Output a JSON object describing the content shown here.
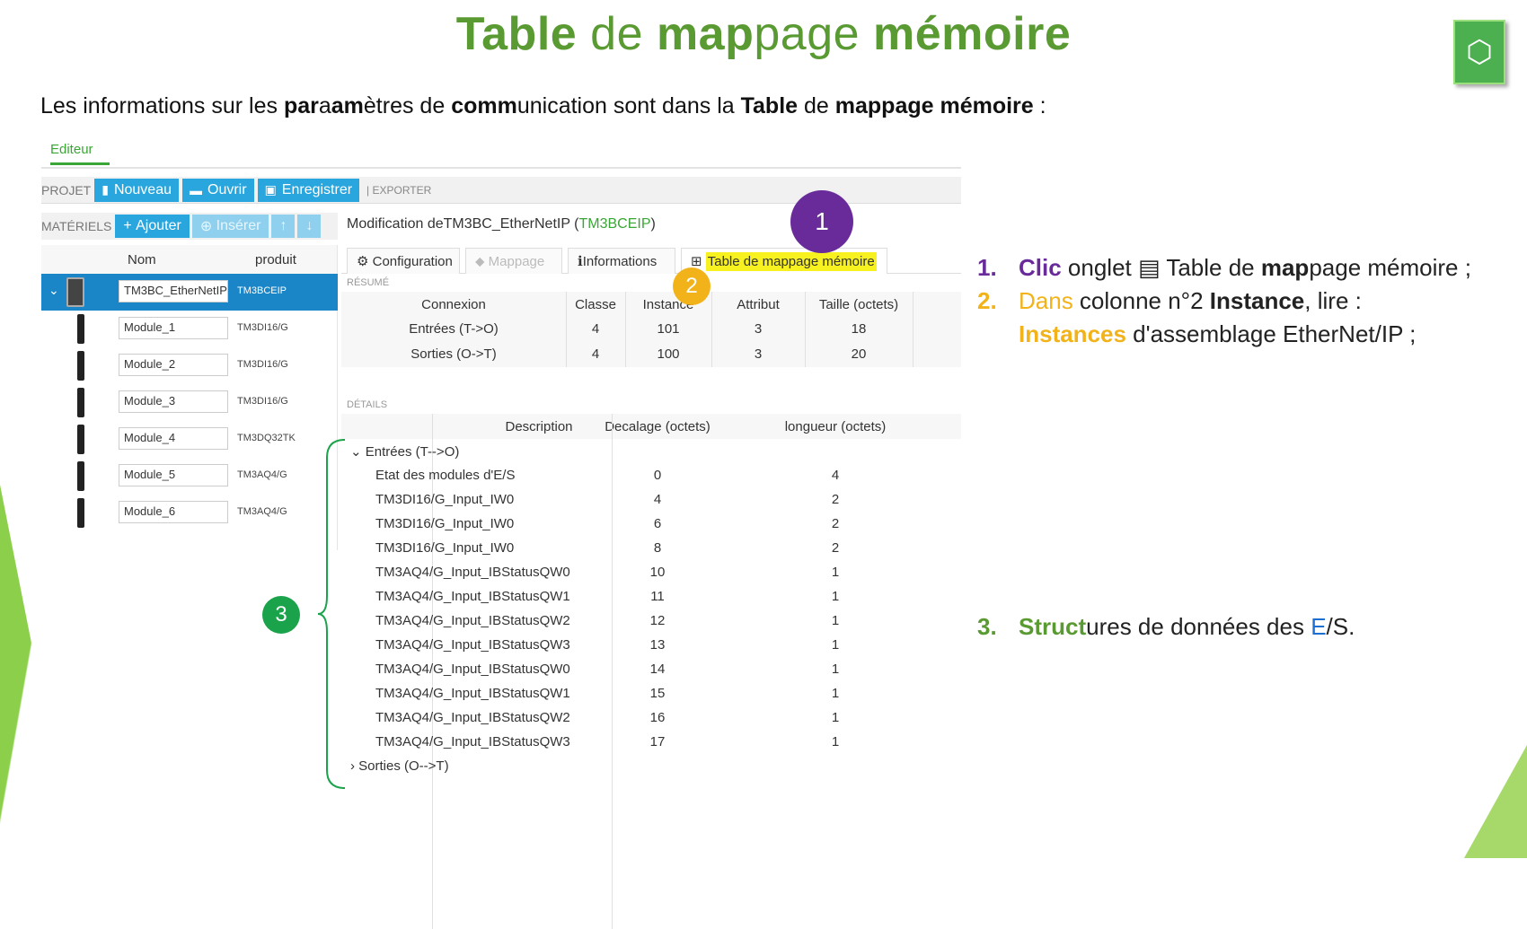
{
  "title": {
    "p1": "Table",
    "p2": " de ",
    "p3": "map",
    "p4": "page ",
    "p5": "mémoire"
  },
  "subtitle": {
    "a": "Les informations sur les ",
    "b": "par",
    "c": "a",
    "d": "am",
    "e": "ètres de ",
    "f": "comm",
    "g": "unication sont dans la ",
    "h": "Table",
    "i": " de ",
    "j": "mappage mémoire",
    "k": " :"
  },
  "editor": {
    "tab_label": "Editeur",
    "toolbar": {
      "projet": "PROJET",
      "nouveau": "Nouveau",
      "ouvrir": "Ouvrir",
      "enregistrer": "Enregistrer",
      "exporter": "| EXPORTER"
    },
    "materiels": {
      "label": "MATÉRIELS",
      "ajouter": "Ajouter",
      "inserer": "Insérer"
    },
    "modification": {
      "prefix": "Modification deTM3BC_EtherNetIP (",
      "ref": "TM3BCEIP",
      "suffix": ")"
    },
    "tree": {
      "col_nom": "Nom",
      "col_produit": "produit",
      "rows": [
        {
          "name": "TM3BC_EtherNetIP",
          "product": "TM3BCEIP"
        },
        {
          "name": "Module_1",
          "product": "TM3DI16/G"
        },
        {
          "name": "Module_2",
          "product": "TM3DI16/G"
        },
        {
          "name": "Module_3",
          "product": "TM3DI16/G"
        },
        {
          "name": "Module_4",
          "product": "TM3DQ32TK"
        },
        {
          "name": "Module_5",
          "product": "TM3AQ4/G"
        },
        {
          "name": "Module_6",
          "product": "TM3AQ4/G"
        }
      ]
    },
    "tabs": {
      "configuration": "Configuration",
      "mappage": "Mappage",
      "informations": "Informations",
      "table": "Table de mappage mémoire"
    },
    "resume": {
      "label": "RÉSUMÉ",
      "headers": [
        "Connexion",
        "Classe",
        "Instance",
        "Attribut",
        "Taille (octets)"
      ],
      "rows": [
        [
          "Entrées (T->O)",
          "4",
          "101",
          "3",
          "18"
        ],
        [
          "Sorties (O->T)",
          "4",
          "100",
          "3",
          "20"
        ]
      ]
    },
    "details": {
      "label": "DÉTAILS",
      "headers": [
        "Description",
        "Decalage (octets)",
        "longueur (octets)"
      ],
      "group_in": "Entrées (T-->O)",
      "group_out": "Sorties (O-->T)",
      "rows": [
        [
          "Etat des modules d'E/S",
          "0",
          "4"
        ],
        [
          "TM3DI16/G_Input_IW0",
          "4",
          "2"
        ],
        [
          "TM3DI16/G_Input_IW0",
          "6",
          "2"
        ],
        [
          "TM3DI16/G_Input_IW0",
          "8",
          "2"
        ],
        [
          "TM3AQ4/G_Input_IBStatusQW0",
          "10",
          "1"
        ],
        [
          "TM3AQ4/G_Input_IBStatusQW1",
          "11",
          "1"
        ],
        [
          "TM3AQ4/G_Input_IBStatusQW2",
          "12",
          "1"
        ],
        [
          "TM3AQ4/G_Input_IBStatusQW3",
          "13",
          "1"
        ],
        [
          "TM3AQ4/G_Input_IBStatusQW0",
          "14",
          "1"
        ],
        [
          "TM3AQ4/G_Input_IBStatusQW1",
          "15",
          "1"
        ],
        [
          "TM3AQ4/G_Input_IBStatusQW2",
          "16",
          "1"
        ],
        [
          "TM3AQ4/G_Input_IBStatusQW3",
          "17",
          "1"
        ]
      ]
    }
  },
  "badges": {
    "one": "1",
    "two": "2",
    "three": "3"
  },
  "notes": {
    "n1": {
      "num": "1.",
      "a": "Clic",
      "b": " onglet ",
      "icon": "▤",
      "c": " Table de ",
      "d": "map",
      "e": "page mémoire ;"
    },
    "n2": {
      "num": "2.",
      "a": "Dans",
      "b": " colonne n°2 ",
      "c": "Instance",
      "d": ", lire :"
    },
    "n2b": {
      "a": "Instances",
      "b": " d'assemblage EtherNet/IP ;"
    },
    "n3": {
      "num": "3.",
      "a": "Struct",
      "b": "ures de données des ",
      "c": "E",
      "d": "/S."
    }
  },
  "colors": {
    "green": "#5a9a32",
    "purple": "#6a2b9a",
    "orange": "#f2b31a",
    "blue": "#2aa6de",
    "badge_green": "#1aa34a"
  }
}
